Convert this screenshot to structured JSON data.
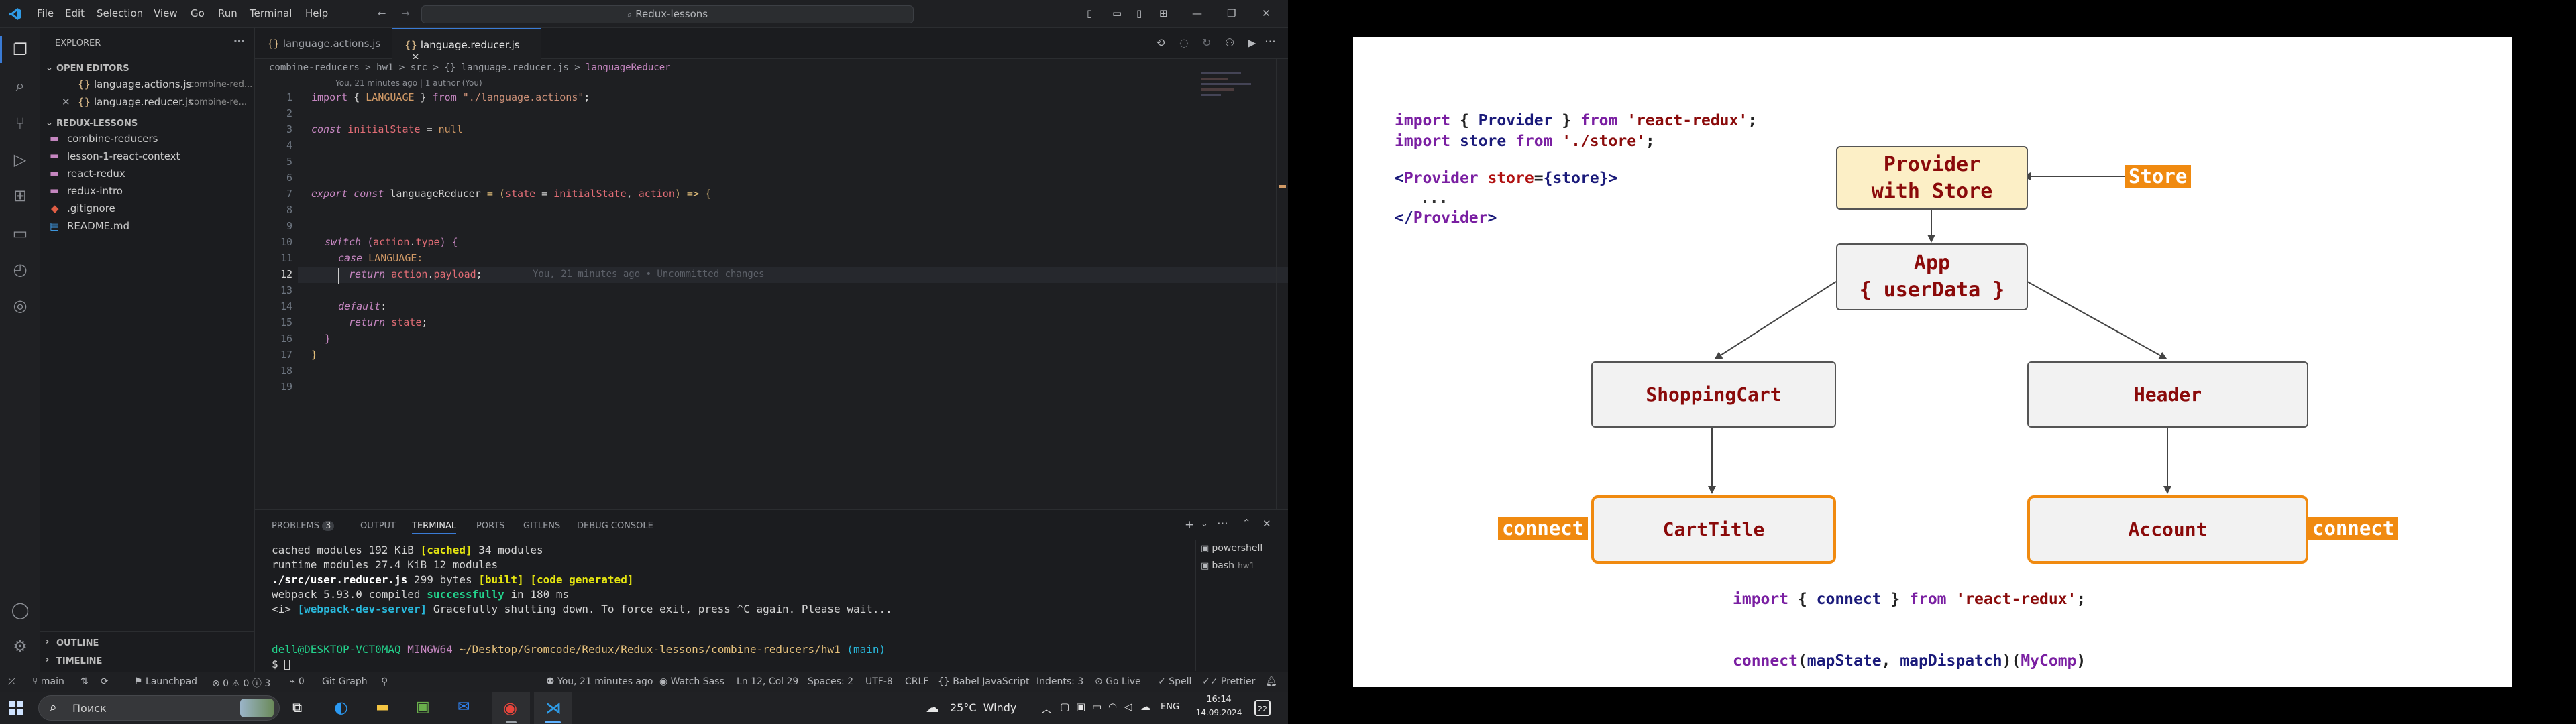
{
  "titlebar": {
    "menus": [
      "File",
      "Edit",
      "Selection",
      "View",
      "Go",
      "Run",
      "Terminal",
      "Help"
    ],
    "search": "Redux-lessons"
  },
  "sidebar": {
    "title": "EXPLORER",
    "open_editors_header": "OPEN EDITORS",
    "open_editors": [
      {
        "name": "language.actions.js",
        "desc": "combine-red..."
      },
      {
        "name": "language.reducer.js",
        "desc": "combine-re..."
      }
    ],
    "project_header": "REDUX-LESSONS",
    "tree": [
      "combine-reducers",
      "lesson-1-react-context",
      "react-redux",
      "redux-intro",
      ".gitignore",
      "README.md"
    ],
    "outline": "OUTLINE",
    "timeline": "TIMELINE"
  },
  "tabs": [
    {
      "label": "language.actions.js",
      "active": false
    },
    {
      "label": "language.reducer.js",
      "active": true
    }
  ],
  "breadcrumb": {
    "parts": [
      "combine-reducers",
      "hw1",
      "src",
      "{} language.reducer.js",
      "languageReducer"
    ],
    "sep": ">"
  },
  "editor": {
    "codelens": "You, 21 minutes ago | 1 author (You)",
    "line_numbers": [
      "1",
      "2",
      "3",
      "4",
      "5",
      "6",
      "7",
      "8",
      "9",
      "10",
      "11",
      "12",
      "13",
      "14",
      "15",
      "16",
      "17",
      "18",
      "19"
    ],
    "blame": "You, 21 minutes ago • Uncommitted changes",
    "code": {
      "l1": {
        "a": "import",
        "b": " { ",
        "c": "LANGUAGE",
        "d": " } ",
        "e": "from",
        "f": " \"./language.actions\"",
        "g": ";"
      },
      "l3": {
        "a": "const",
        "b": " initialState",
        "c": " = ",
        "d": "null"
      },
      "l7": {
        "a": "export",
        "b": " const ",
        "c": "languageReducer",
        "d": " = (",
        "e": "state",
        "f": " = ",
        "g": "initialState",
        "h": ", ",
        "i": "action",
        "j": ") => {"
      },
      "l10": {
        "a": "switch",
        "b": " (",
        "c": "action",
        "d": ".",
        "e": "type",
        "f": ") {"
      },
      "l11": {
        "a": "case",
        "b": " LANGUAGE:"
      },
      "l12": {
        "a": "return",
        "b": " action",
        "c": ".",
        "d": "payload",
        "e": ";"
      },
      "l14": {
        "a": "default",
        "b": ":"
      },
      "l15": {
        "a": "return",
        "b": " state",
        "c": ";"
      },
      "l16": "}",
      "l17": "}"
    }
  },
  "panel": {
    "tabs": [
      {
        "label": "PROBLEMS",
        "badge": "3"
      },
      {
        "label": "OUTPUT"
      },
      {
        "label": "TERMINAL"
      },
      {
        "label": "PORTS"
      },
      {
        "label": "GITLENS"
      },
      {
        "label": "DEBUG CONSOLE"
      }
    ],
    "terminal_lines": [
      {
        "a": "cached modules 192 KiB ",
        "b": "[cached]",
        "c": " 34 modules"
      },
      {
        "a": "runtime modules 27.4 KiB 12 modules"
      },
      {
        "a": "./src/user.reducer.js",
        "b": " 299 bytes ",
        "c": "[built] [code generated]"
      },
      {
        "a": "webpack 5.93.0 compiled ",
        "b": "successfully",
        "c": " in 180 ms"
      },
      {
        "a": "<i> ",
        "b": "[webpack-dev-server]",
        "c": " Gracefully shutting down. To force exit, press ^C again. Please wait..."
      }
    ],
    "prompt": {
      "user": "dell@DESKTOP-VCT0MAQ",
      "shell": "MINGW64",
      "path": "~/Desktop/Gromcode/Redux/Redux-lessons/combine-reducers/hw1",
      "branch": "(main)",
      "sym": "$"
    },
    "terminals": [
      {
        "name": "powershell",
        "desc": ""
      },
      {
        "name": "bash",
        "desc": "hw1"
      }
    ]
  },
  "status": {
    "branch": "main",
    "launchpad": "Launchpad",
    "problems": "⊗ 0 ⚠ 0 ⓘ 3",
    "ports": "0",
    "gitgraph": "Git Graph",
    "blame": "You, 21 minutes ago",
    "watch": "Watch Sass",
    "position": "Ln 12, Col 29",
    "spaces": "Spaces: 2",
    "encoding": "UTF-8",
    "eol": "CRLF",
    "language": "{} Babel JavaScript",
    "indents": "Indents: 3",
    "golive": "Go Live",
    "spell": "Spell",
    "prettier": "Prettier"
  },
  "taskbar": {
    "search": "Поиск",
    "weather": "25°C  Windy",
    "lang": "ENG",
    "time": "16:14",
    "date": "14.09.2024",
    "notif": "22"
  },
  "slide": {
    "code_lines": [
      {
        "a": "import",
        "b": " { ",
        "c": "Provider",
        "d": " } ",
        "e": "from",
        "f": " 'react-redux'",
        "g": ";"
      },
      {
        "a": "import",
        "b": " store ",
        "c": "from",
        "d": " './store'",
        "e": ";"
      }
    ],
    "provider_open": {
      "a": "<",
      "b": "Provider",
      "c": " store",
      "d": "=",
      "e": "{store}",
      "f": ">"
    },
    "ellipsis": "...",
    "provider_close": {
      "a": "</",
      "b": "Provider",
      "c": ">"
    },
    "boxes": {
      "provider": [
        "Provider",
        "with Store"
      ],
      "app": [
        "App",
        "{ userData }"
      ],
      "cart": "ShoppingCart",
      "header": "Header",
      "carttitle": "CartTitle",
      "account": "Account"
    },
    "store_tag": "Store",
    "connect_left": "connect",
    "connect_right": "connect",
    "import_connect": {
      "a": "import",
      "b": " { ",
      "c": "connect",
      "d": " } ",
      "e": "from",
      "f": " 'react-redux'",
      "g": ";"
    },
    "connect_call": {
      "a": "connect",
      "b": "(",
      "c": "mapState",
      "d": ", ",
      "e": "mapDispatch",
      "f": ")(",
      "g": "MyComp",
      "h": ")"
    },
    "colors": {
      "orange": "#f08a10",
      "provider_fill": "#fcefc6",
      "keyword": "#7a1fa2",
      "dark_red": "#8a0a0a"
    }
  }
}
